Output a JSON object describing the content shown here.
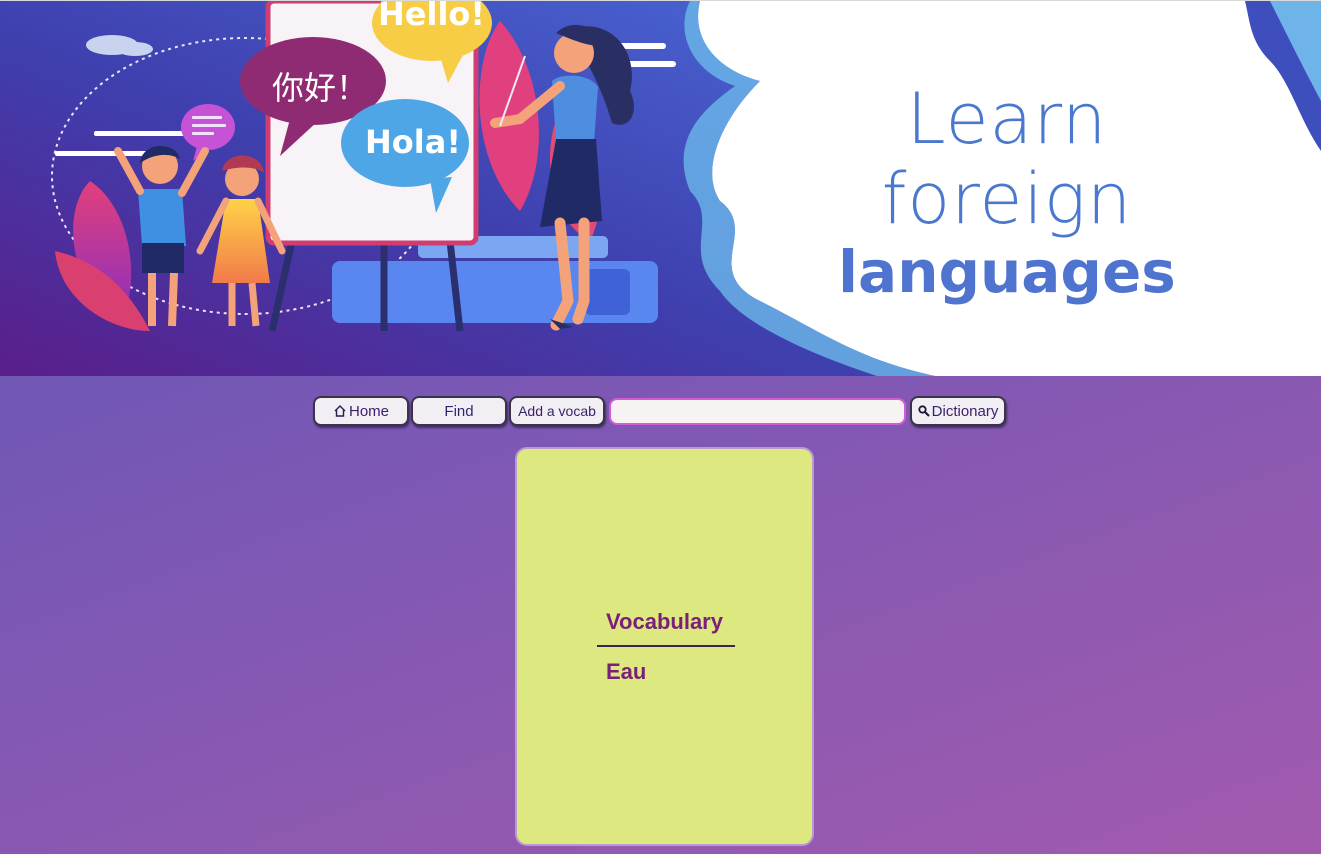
{
  "banner": {
    "headline_line1": "Learn foreign",
    "headline_line2": "languages",
    "bubble_hello": "Hello!",
    "bubble_nihao": "你好！",
    "bubble_hola": "Hola!"
  },
  "nav": {
    "home_label": "Home",
    "find_label": "Find",
    "add_vocab_label": "Add a vocab",
    "search_value": "",
    "dictionary_label": "Dictionary"
  },
  "card": {
    "heading": "Vocabulary",
    "word": "Eau"
  },
  "colors": {
    "background_start": "#5c55b3",
    "background_end": "#a25aae",
    "card_bg": "#dde980",
    "card_text": "#7b2078",
    "banner_title": "#4a78cf"
  }
}
